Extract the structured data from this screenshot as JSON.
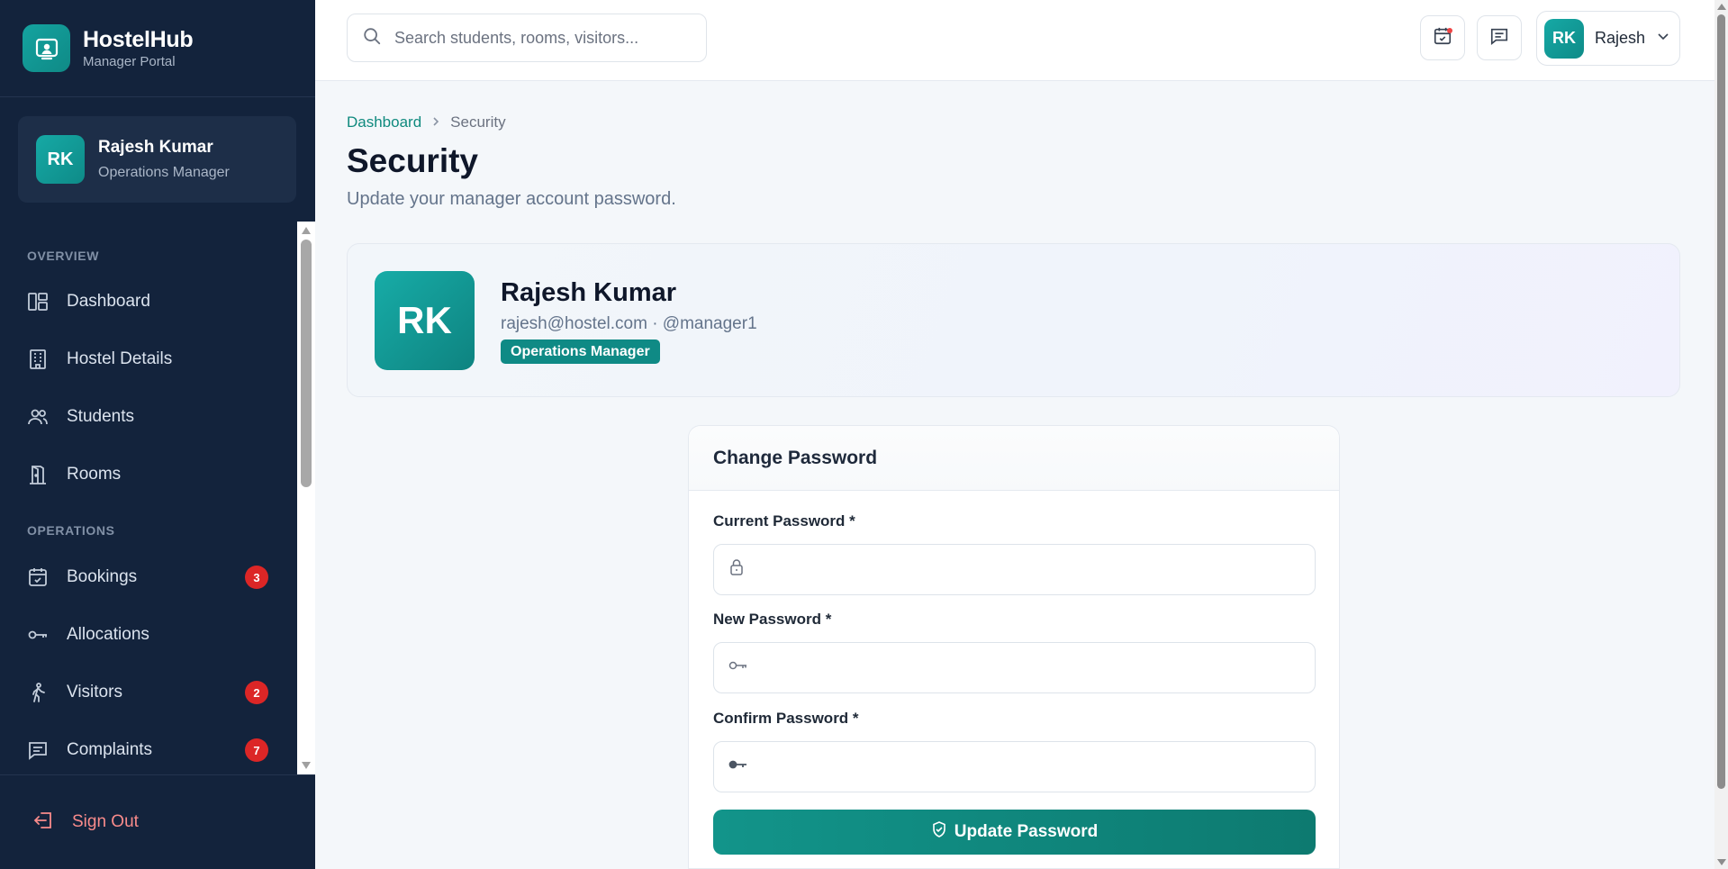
{
  "brand": {
    "name": "HostelHub",
    "subtitle": "Manager Portal"
  },
  "sidebar": {
    "user": {
      "initials": "RK",
      "name": "Rajesh Kumar",
      "role": "Operations Manager"
    },
    "sections": [
      {
        "label": "OVERVIEW"
      },
      {
        "label": "OPERATIONS"
      }
    ],
    "items": [
      {
        "label": "Dashboard",
        "icon": "dashboard-icon"
      },
      {
        "label": "Hostel Details",
        "icon": "building-icon"
      },
      {
        "label": "Students",
        "icon": "users-icon"
      },
      {
        "label": "Rooms",
        "icon": "door-icon"
      },
      {
        "label": "Bookings",
        "icon": "calendar-check-icon",
        "badge": "3"
      },
      {
        "label": "Allocations",
        "icon": "key-icon"
      },
      {
        "label": "Visitors",
        "icon": "walking-person-icon",
        "badge": "2"
      },
      {
        "label": "Complaints",
        "icon": "message-icon",
        "badge": "7"
      }
    ],
    "sign_out": "Sign Out"
  },
  "topbar": {
    "search_placeholder": "Search students, rooms, visitors...",
    "profile": {
      "initials": "RK",
      "name": "Rajesh"
    }
  },
  "breadcrumb": {
    "parent": "Dashboard",
    "current": "Security"
  },
  "page": {
    "title": "Security",
    "subtitle": "Update your manager account password."
  },
  "profile_card": {
    "initials": "RK",
    "name": "Rajesh Kumar",
    "meta": "rajesh@hostel.com · @manager1",
    "role": "Operations Manager"
  },
  "password_form": {
    "title": "Change Password",
    "current_label": "Current Password *",
    "new_label": "New Password *",
    "confirm_label": "Confirm Password *",
    "submit_label": "Update Password"
  },
  "colors": {
    "accent": "#0f8a85",
    "sidebar_bg": "#13233c",
    "badge": "#dc2626",
    "sign_out": "#f98b8b"
  }
}
